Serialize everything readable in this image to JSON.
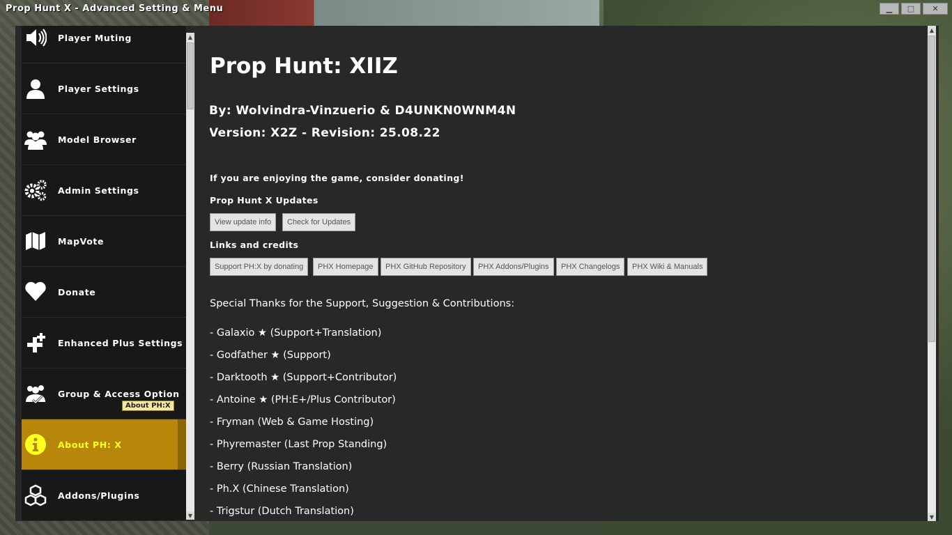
{
  "window": {
    "title": "Prop Hunt X - Advanced Setting & Menu",
    "minimize": "▁",
    "maximize": "□",
    "close": "✕"
  },
  "sidebar": {
    "items": [
      {
        "label": "Player Muting",
        "icon": "speaker-icon"
      },
      {
        "label": "Player Settings",
        "icon": "user-icon"
      },
      {
        "label": "Model Browser",
        "icon": "users-icon"
      },
      {
        "label": "Admin Settings",
        "icon": "gears-icon"
      },
      {
        "label": "MapVote",
        "icon": "map-icon"
      },
      {
        "label": "Donate",
        "icon": "heart-icon"
      },
      {
        "label": "Enhanced Plus Settings",
        "icon": "plus-icon"
      },
      {
        "label": "Group & Access Option",
        "icon": "group-check-icon"
      },
      {
        "label": "About PH: X",
        "icon": "info-icon",
        "active": true
      },
      {
        "label": "Addons/Plugins",
        "icon": "boxes-icon"
      }
    ],
    "tooltip": "About PH:X",
    "active_color": "#b8860b",
    "active_text_color": "#ffff22"
  },
  "content": {
    "title": "Prop Hunt: XIIZ",
    "by": "By: Wolvindra-Vinzuerio & D4UNKN0WNM4N",
    "version": "Version: X2Z - Revision: 25.08.22",
    "donate_prompt": "If you are enjoying the game, consider donating!",
    "updates_heading": "Prop Hunt X Updates",
    "update_buttons": [
      "View update info",
      "Check for Updates"
    ],
    "links_heading": "Links and credits",
    "link_buttons": [
      "Support PH:X by donating",
      "PHX Homepage",
      "PHX GitHub Repository",
      "PHX Addons/Plugins",
      "PHX Changelogs",
      "PHX Wiki & Manuals"
    ],
    "thanks_heading": "Special Thanks for the Support, Suggestion & Contributions:",
    "credits": [
      "- Galaxio ★ (Support+Translation)",
      "- Godfather ★ (Support)",
      "- Darktooth ★ (Support+Contributor)",
      "- Antoine ★ (PH:E+/Plus Contributor)",
      "- Fryman (Web & Game Hosting)",
      "- Phyremaster (Last Prop Standing)",
      "- Berry (Russian Translation)",
      "- Ph.X (Chinese Translation)",
      "- Trigstur (Dutch Translation)"
    ]
  }
}
